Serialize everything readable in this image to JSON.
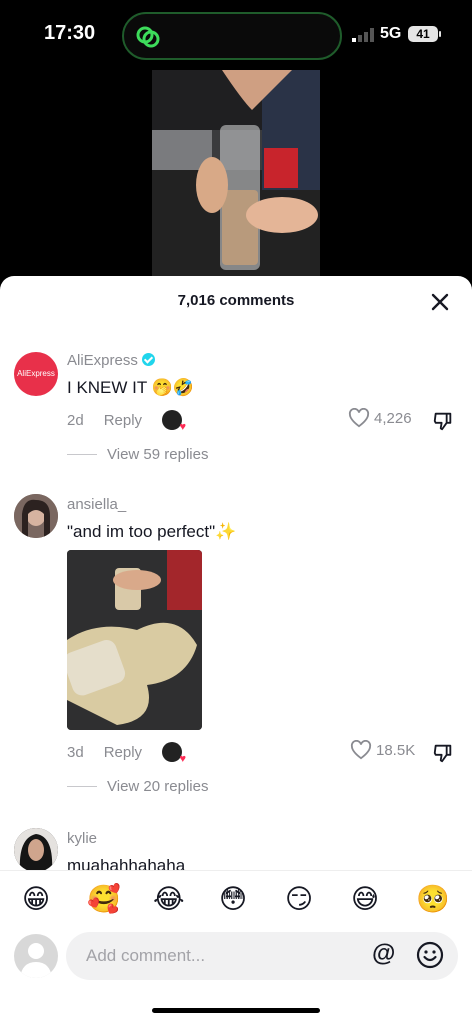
{
  "status": {
    "time": "17:30",
    "network": "5G",
    "battery": "41"
  },
  "sheet": {
    "title": "7,016 comments"
  },
  "comments": [
    {
      "avatar_text": "AliExpress",
      "username": "AliExpress",
      "verified": true,
      "text": "I KNEW IT 🤭🤣",
      "age": "2d",
      "reply_label": "Reply",
      "likes": "4,226",
      "view_replies": "View 59 replies"
    },
    {
      "username": "ansiella_",
      "text": "\"and im too perfect\"✨",
      "age": "3d",
      "reply_label": "Reply",
      "likes": "18.5K",
      "view_replies": "View 20 replies"
    },
    {
      "username": "kylie",
      "text": "muahahhahaha"
    }
  ],
  "emoji_bar": [
    "😁",
    "🥰",
    "😂",
    "😳",
    "😏",
    "😅",
    "🥺"
  ],
  "input": {
    "placeholder": "Add comment...",
    "at_label": "@"
  },
  "colors": {
    "accent_red": "#fe2c55",
    "verified": "#20d5ec",
    "island_border": "#1f5c2b"
  }
}
